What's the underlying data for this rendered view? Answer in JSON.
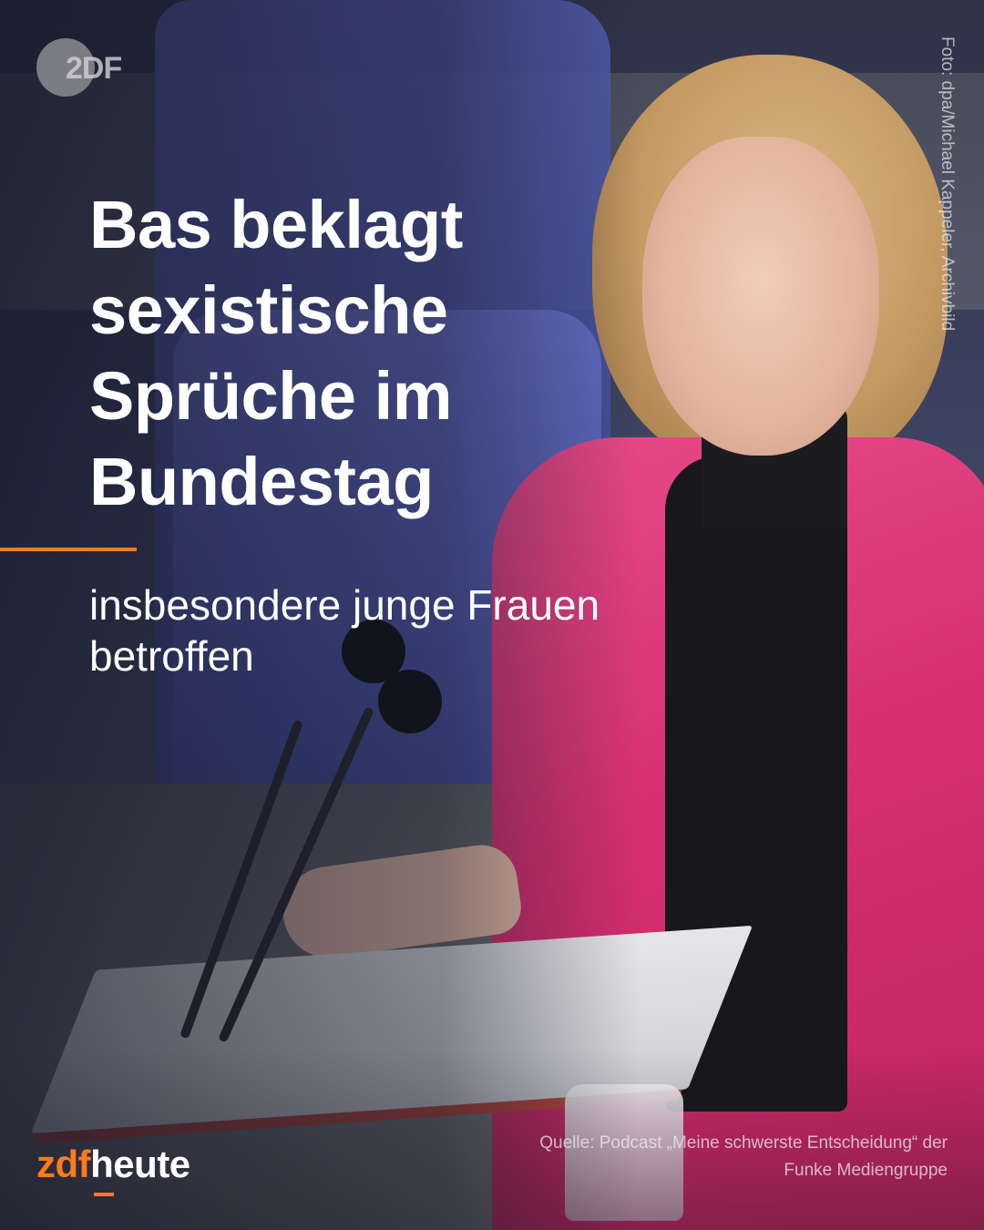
{
  "logo_top": {
    "text": "2DF"
  },
  "headline": "Bas beklagt sexistische Sprüche im Bundestag",
  "subline": "insbesondere junge Frauen betroffen",
  "photo_credit": "Foto: dpa/Michael Kappeler, Archivbild",
  "brand": {
    "part1": "zdf",
    "part2": "heute"
  },
  "source": "Quelle: Podcast „Meine schwerste Entscheidung“ der Funke Mediengruppe",
  "colors": {
    "accent": "#ff7a1a",
    "jacket": "#d62f72",
    "text": "#ffffff"
  }
}
